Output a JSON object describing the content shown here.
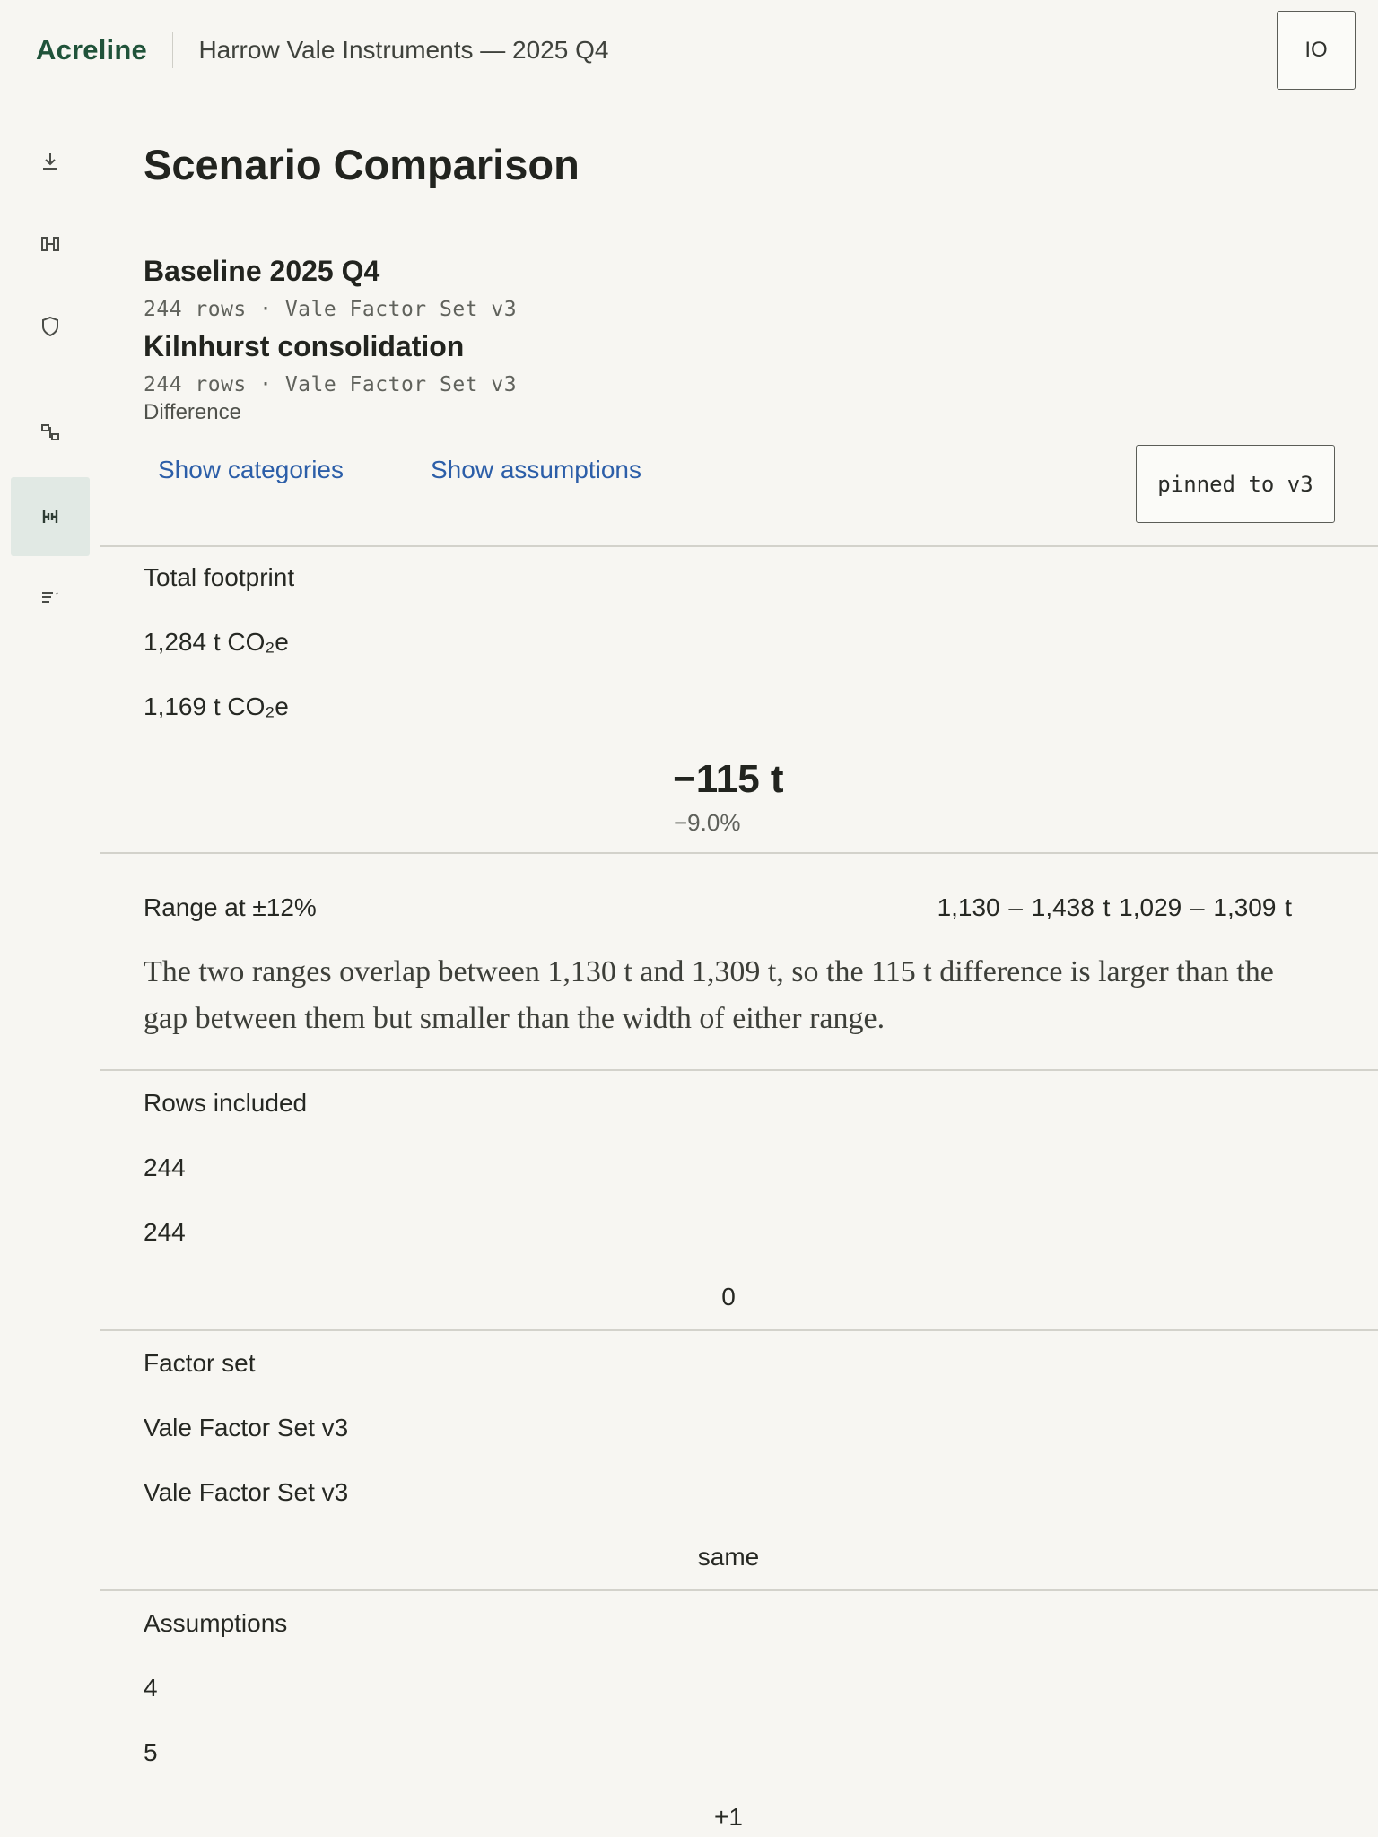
{
  "app": {
    "name": "Acreline",
    "project": "Harrow Vale Instruments — 2025 Q4",
    "user_initials": "IO"
  },
  "sidebar": {
    "items": [
      {
        "icon": "download-icon",
        "active": false
      },
      {
        "icon": "compare-columns-icon",
        "active": false
      },
      {
        "icon": "shield-icon",
        "active": false
      },
      {
        "icon": "hierarchy-icon",
        "active": false
      },
      {
        "icon": "scenario-compare-icon",
        "active": true
      },
      {
        "icon": "list-sort-icon",
        "active": false
      }
    ]
  },
  "page": {
    "title": "Scenario Comparison",
    "scenario_a": {
      "name": "Baseline 2025 Q4",
      "meta": "244 rows · Vale Factor Set v3"
    },
    "scenario_b": {
      "name": "Kilnhurst consolidation",
      "meta": "244 rows · Vale Factor Set v3"
    },
    "difference_label": "Difference",
    "show_categories": "Show categories",
    "show_assumptions": "Show assumptions",
    "pin_label": "pinned to v3"
  },
  "rows": {
    "total": {
      "label": "Total footprint",
      "a": "1,284 t CO₂e",
      "b": "1,169 t CO₂e",
      "diff": "−115 t",
      "diff_pct": "−9.0%"
    },
    "range": {
      "label": "Range at ±12%",
      "a": "1,130 – 1,438 t",
      "b": "1,029 – 1,309 t",
      "note": "The two ranges overlap between 1,130 t and 1,309 t, so the 115 t difference is larger than the gap between them but smaller than the width of either range."
    },
    "rows_included": {
      "label": "Rows included",
      "a": "244",
      "b": "244",
      "diff": "0"
    },
    "factor_set": {
      "label": "Factor set",
      "a": "Vale Factor Set v3",
      "b": "Vale Factor Set v3",
      "diff": "same"
    },
    "assumptions": {
      "label": "Assumptions",
      "a": "4",
      "b": "5",
      "diff": "+1"
    }
  },
  "colors": {
    "brand": "#20533a",
    "link": "#2c5ea8",
    "active_nav_bg": "#e1e9e4",
    "background": "#f7f6f2"
  }
}
